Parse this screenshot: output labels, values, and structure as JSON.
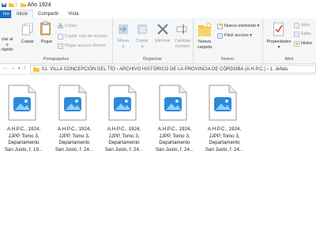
{
  "window": {
    "title": "Año 1924"
  },
  "tabs": [
    {
      "label": "ivo"
    },
    {
      "label": "Inicio"
    },
    {
      "label": "Compartir"
    },
    {
      "label": "Vista"
    }
  ],
  "ribbon": {
    "portapapeles": {
      "pin_label_1": "clar al",
      "pin_label_2": "o rápido",
      "copiar": "Copiar",
      "pegar": "Pegar",
      "cortar": "Cortar",
      "copiar_ruta": "Copiar ruta de acceso",
      "pegar_acceso": "Pegar acceso directo",
      "group": "Portapapeles"
    },
    "organizar": {
      "mover_1": "Mover",
      "mover_2": "a",
      "copiar_1": "Copiar",
      "copiar_2": "a",
      "eliminar": "Eliminar",
      "cambiar_1": "Cambiar",
      "cambiar_2": "nombre",
      "group": "Organizar"
    },
    "nuevo": {
      "nueva_1": "Nueva",
      "nueva_2": "carpeta",
      "nuevo_elemento": "Nuevo elemento",
      "facil_acceso": "Fácil acceso",
      "group": "Nuevo"
    },
    "abrir": {
      "propiedades": "Propiedades",
      "abrir": "Abrir",
      "editar": "Edita",
      "historial": "Histor",
      "group": "Abrir"
    }
  },
  "address": {
    "crumbs": "01. VILLA CONCEPCIÓN DEL TÍO  ›  ARCHIVO HISTÓRICO DE LA PROVINCIA DE CÓRDOBA (A.H.P.C.)  ›  1. Jefatu"
  },
  "files": [
    {
      "lines": [
        "A.H.P.C., 1924,",
        "JJPP, Tomo 3,",
        "Departamento",
        "San Justo, f. 19..."
      ]
    },
    {
      "lines": [
        "A.H.P.C., 1924,",
        "JJPP, Tomo 3,",
        "Departamento",
        "San Justo, f. 24..."
      ]
    },
    {
      "lines": [
        "A.H.P.C., 1924,",
        "JJPP, Tomo 3,",
        "Departamento",
        "San Justo, f. 24..."
      ]
    },
    {
      "lines": [
        "A.H.P.C., 1924,",
        "JJPP, Tomo 3,",
        "Departamento",
        "San Justo, f. 24..."
      ]
    },
    {
      "lines": [
        "A.H.P.C., 1924,",
        "JJPP, Tomo 3,",
        "Departamento",
        "San Justo, f. 24..."
      ]
    }
  ],
  "colors": {
    "accent": "#1a6ec4",
    "folder": "#f3c540",
    "image_icon": "#2d8ad8"
  }
}
